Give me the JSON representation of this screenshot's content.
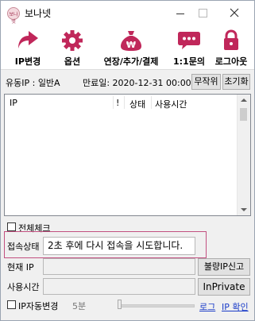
{
  "window": {
    "title": "보나넷",
    "app_icon_text": "보나넷"
  },
  "toolbar": [
    {
      "label": "IP변경",
      "icon": "share-arrow-icon",
      "color": "#c0275a"
    },
    {
      "label": "옵션",
      "icon": "gear-icon",
      "color": "#c0275a"
    },
    {
      "label": "연장/추가/결제",
      "icon": "money-bag-icon",
      "color": "#c0275a"
    },
    {
      "label": "1:1문의",
      "icon": "chat-bubble-icon",
      "color": "#c0275a"
    },
    {
      "label": "로그아웃",
      "icon": "lock-icon",
      "color": "#c0275a"
    }
  ],
  "info": {
    "flow_ip": "유동IP : 일반A",
    "expiry": "만료일: 2020-12-31 00:00",
    "random_button": "무작위",
    "reset_button": "초기화"
  },
  "list": {
    "columns": [
      "IP",
      "!",
      "상태",
      "사용시간"
    ],
    "rows": []
  },
  "check_all_label": "전체체크",
  "status": {
    "label": "접속상태",
    "value": "2초 후에 다시 접속을 시도합니다."
  },
  "current_ip": {
    "label": "현재 IP",
    "value": "",
    "report_button": "불량IP신고"
  },
  "usage_time": {
    "label": "사용시간",
    "value": "",
    "inprivate_button": "InPrivate"
  },
  "bottom": {
    "auto_change_label": "IP자동변경",
    "interval": "5분",
    "log_link": "로그",
    "ip_check_link": "IP 확인"
  },
  "colors": {
    "accent": "#c0275a",
    "highlight_border": "#c25080",
    "link": "#1a3cc8"
  }
}
